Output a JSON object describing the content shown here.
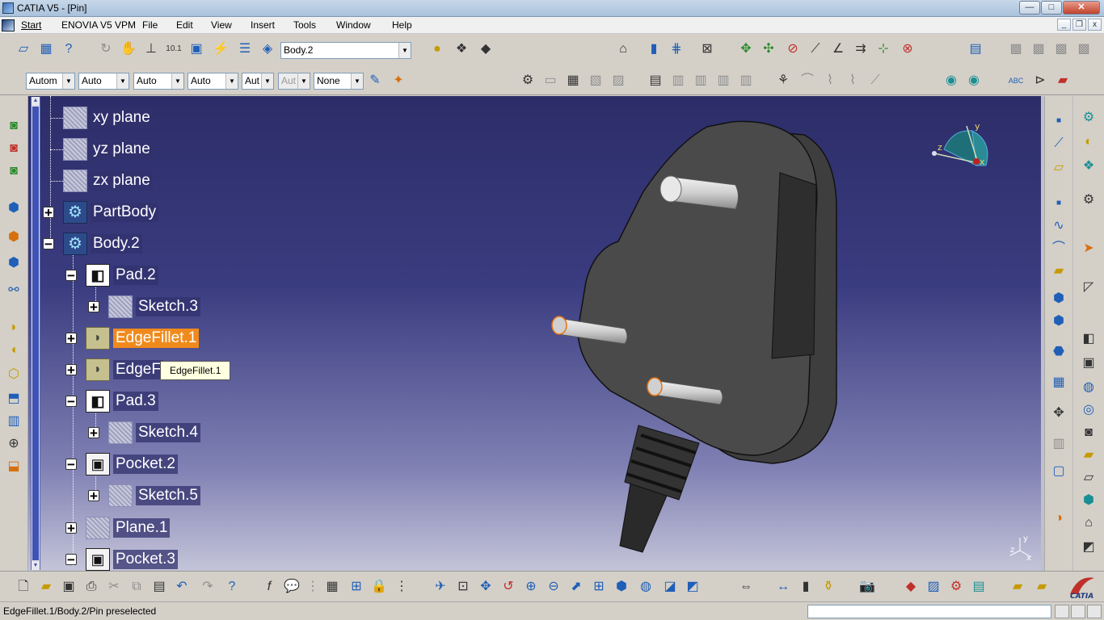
{
  "window": {
    "title": "CATIA V5 - [Pin]",
    "buttons": {
      "minimize": "—",
      "maximize": "□",
      "close": "✕"
    }
  },
  "menubar": {
    "items": [
      "Start",
      "ENOVIA V5 VPM",
      "File",
      "Edit",
      "View",
      "Insert",
      "Tools",
      "Window",
      "Help"
    ],
    "mdi": {
      "minimize": "_",
      "restore": "❐",
      "close": "x"
    }
  },
  "toolbar": {
    "current_body": "Body.2",
    "graphic_properties": [
      "Autom",
      "Auto",
      "Auto",
      "Auto",
      "Aut",
      "Aut",
      "None"
    ]
  },
  "tree": {
    "nodes": [
      {
        "label": "xy plane",
        "type": "plane"
      },
      {
        "label": "yz plane",
        "type": "plane"
      },
      {
        "label": "zx plane",
        "type": "plane"
      },
      {
        "label": "PartBody",
        "type": "body"
      },
      {
        "label": "Body.2",
        "type": "body"
      },
      {
        "label": "Pad.2",
        "type": "pad"
      },
      {
        "label": "Sketch.3",
        "type": "sketch"
      },
      {
        "label": "EdgeFillet.1",
        "type": "fillet",
        "selected": true
      },
      {
        "label": "EdgeF",
        "type": "fillet"
      },
      {
        "label": "Pad.3",
        "type": "pad"
      },
      {
        "label": "Sketch.4",
        "type": "sketch"
      },
      {
        "label": "Pocket.2",
        "type": "pocket"
      },
      {
        "label": "Sketch.5",
        "type": "sketch"
      },
      {
        "label": "Plane.1",
        "type": "plane"
      },
      {
        "label": "Pocket.3",
        "type": "pocket"
      }
    ],
    "tooltip": "EdgeFillet.1"
  },
  "compass": {
    "x_label": "x",
    "y_label": "y",
    "z_label": "z"
  },
  "axis_mini": {
    "x_label": "x",
    "y_label": "y",
    "z_label": "z"
  },
  "status": {
    "message": "EdgeFillet.1/Body.2/Pin preselected"
  },
  "brand": {
    "logo_text": "CATIA"
  },
  "colors": {
    "selection": "#f08a1c",
    "viewport_top": "#2c2d68",
    "viewport_bottom": "#c4c4d9"
  }
}
